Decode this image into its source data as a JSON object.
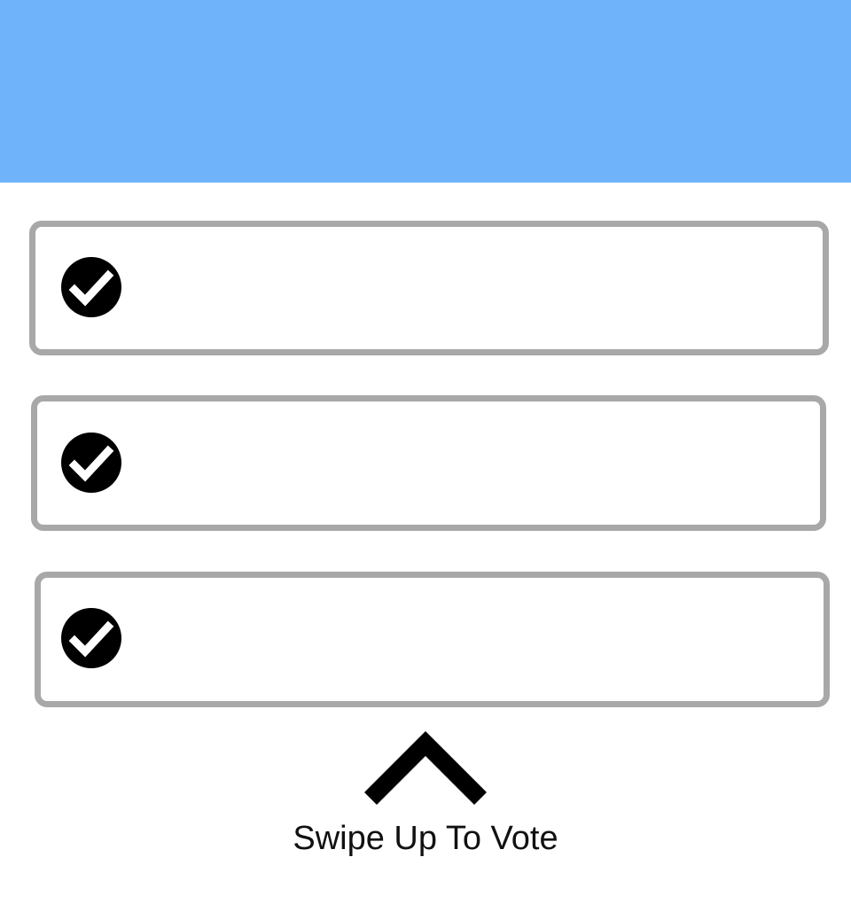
{
  "header": {
    "background_color": "#6fb3fa"
  },
  "options": [
    {
      "label": "",
      "icon": "check-circle-icon",
      "selected": true
    },
    {
      "label": "",
      "icon": "check-circle-icon",
      "selected": true
    },
    {
      "label": "",
      "icon": "check-circle-icon",
      "selected": true
    }
  ],
  "swipe": {
    "icon": "chevron-up-icon",
    "label": "Swipe Up To Vote"
  },
  "colors": {
    "option_border": "#a8a8a8",
    "check_circle": "#000000",
    "check_mark": "#ffffff",
    "text": "#111111"
  }
}
